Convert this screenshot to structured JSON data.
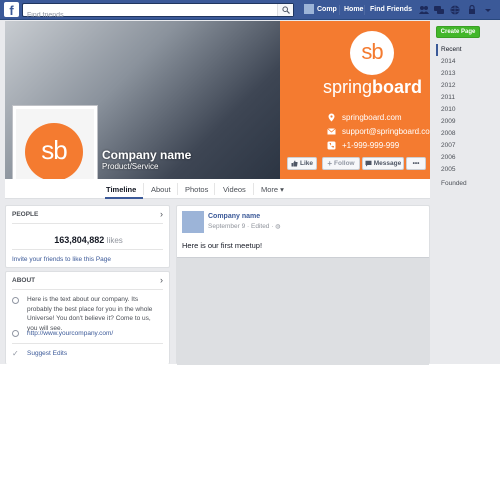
{
  "topbar": {
    "logo": "f",
    "search_placeholder": "Find friends",
    "user_name": "Comp",
    "home": "Home",
    "find_friends": "Find Friends"
  },
  "cover": {
    "brand_left": "spring",
    "brand_right": "board",
    "logo_mark": "sb",
    "website": "springboard.com",
    "email": "support@springboard.com",
    "phone": "+1-999-999-999"
  },
  "page": {
    "name": "Company name",
    "category": "Product/Service",
    "profile_mark": "sb"
  },
  "actions": {
    "like": "Like",
    "follow": "Follow",
    "message": "Message",
    "more": "•••"
  },
  "tabs": [
    "Timeline",
    "About",
    "Photos",
    "Videos",
    "More ▾"
  ],
  "people": {
    "heading": "PEOPLE",
    "likes_count": "163,804,882",
    "likes_word": "likes",
    "invite": "Invite your friends to like this Page"
  },
  "about": {
    "heading": "ABOUT",
    "text": "Here is the text about our company. Its probably the best place for you in the whole Universe! You don't believe it? Come to us, you will see.",
    "link": "http://www.yourcompany.com/",
    "suggest": "Suggest Edits"
  },
  "post": {
    "author": "Company name",
    "meta": "September 9 · Edited · ",
    "text": "Here is our first meetup!"
  },
  "sidebar": {
    "create_page": "Create Page",
    "years": [
      "Recent",
      "2014",
      "2013",
      "2012",
      "2011",
      "2010",
      "2009",
      "2008",
      "2007",
      "2006",
      "2005",
      "Founded"
    ],
    "active_year": "Recent"
  },
  "colors": {
    "facebook_blue": "#3b5998",
    "brand_orange": "#f47b30",
    "create_green": "#42b72a"
  }
}
